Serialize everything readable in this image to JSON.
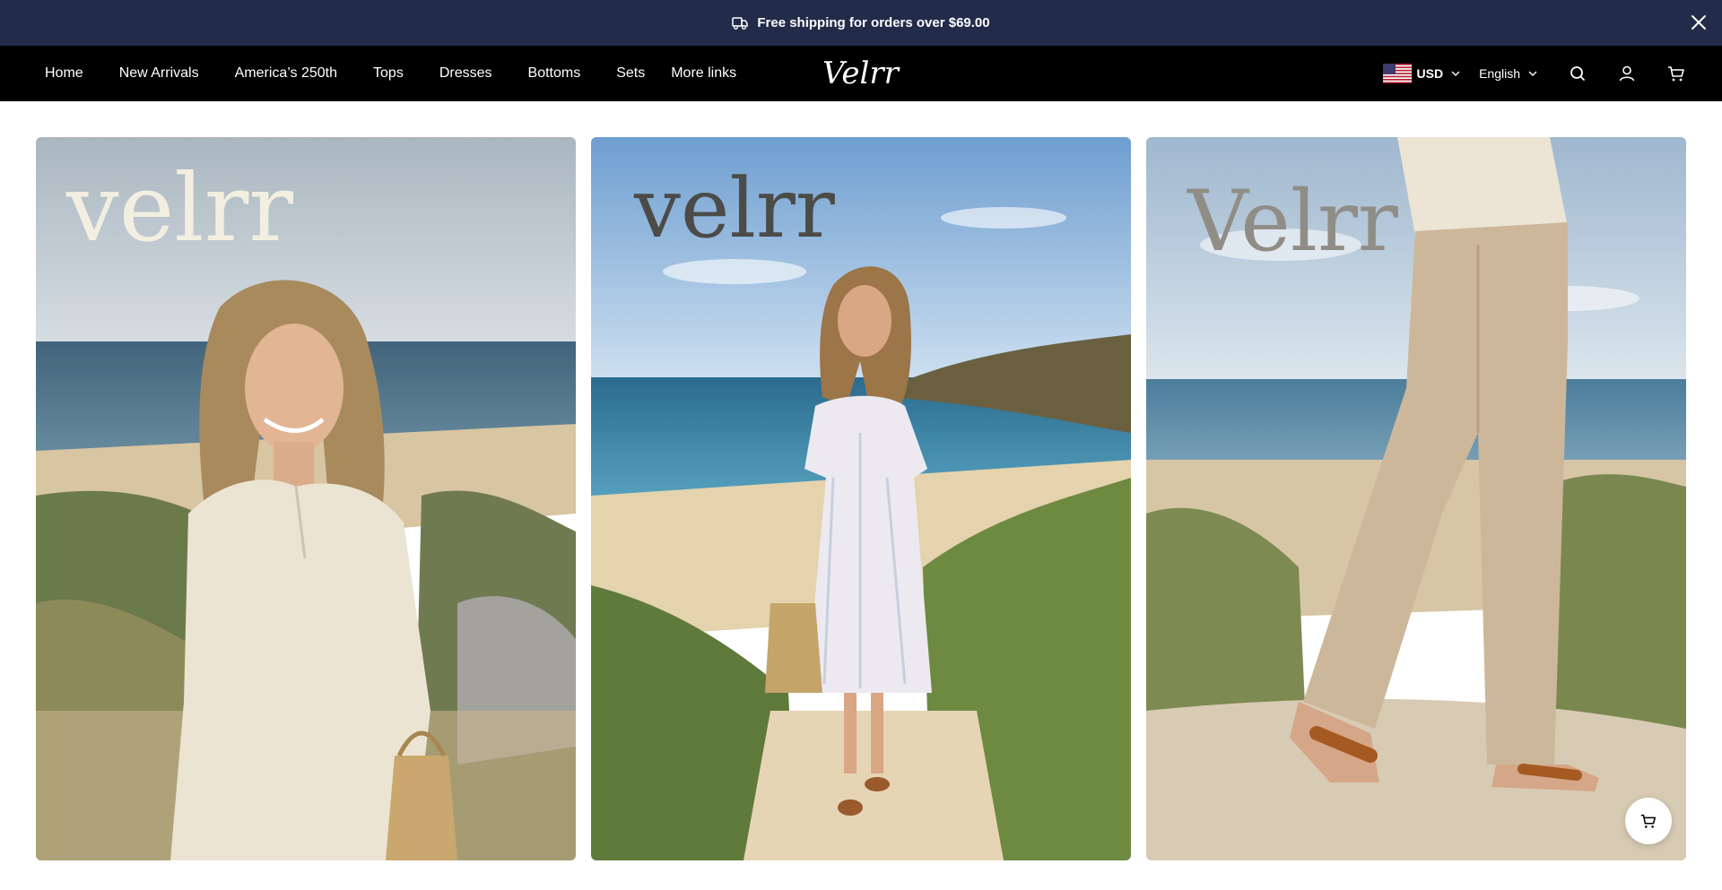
{
  "announcement": {
    "text": "Free shipping for orders over $69.00",
    "icon": "truck-icon",
    "close_icon": "close-icon"
  },
  "nav": {
    "links": [
      "Home",
      "New Arrivals",
      "America’s 250th",
      "Tops",
      "Dresses",
      "Bottoms",
      "Sets",
      "More links"
    ],
    "logo": "Velrr",
    "currency": "USD",
    "currency_flag": "us-flag-icon",
    "language": "English",
    "icons": [
      "search-icon",
      "account-icon",
      "cart-icon"
    ]
  },
  "gallery": {
    "cards": [
      {
        "brand": "velrr",
        "brand_color": "#f3efe0",
        "subject": "woman in linen top on beach dunes"
      },
      {
        "brand": "velrr",
        "brand_color": "#4b4b47",
        "subject": "woman in white linen dress on beach path"
      },
      {
        "brand": "Velrr",
        "brand_color": "#8f8d86",
        "subject": "linen trousers and leather sandals on sand"
      }
    ]
  },
  "floating_cart": {
    "icon": "cart-icon"
  },
  "colors": {
    "announcement_bg": "#232b4a",
    "nav_bg": "#000000"
  }
}
